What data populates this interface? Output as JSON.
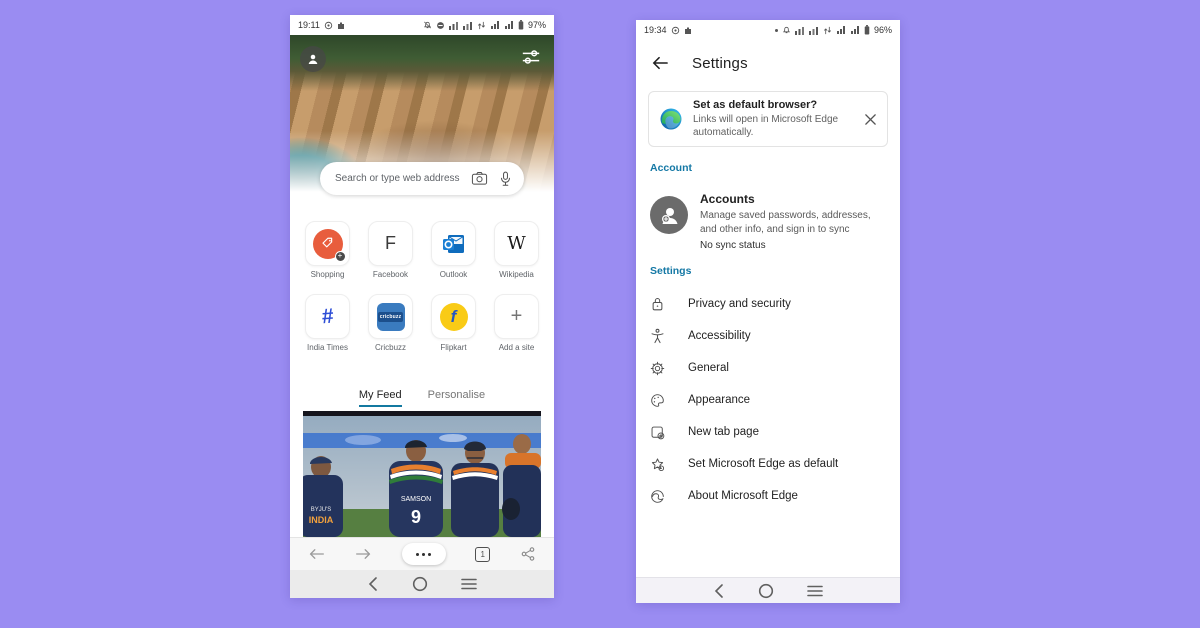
{
  "colors": {
    "page_background": "#9a8cf2",
    "accent_section": "#1478a5",
    "tab_underline": "#1379a0",
    "shopping_red": "#e85d3d",
    "flipkart_yellow": "#f9cb16",
    "edge_blue": "#0c59a4"
  },
  "left_phone": {
    "status": {
      "time": "19:11",
      "battery_pct": "97%"
    },
    "search": {
      "placeholder": "Search or type web address"
    },
    "shortcuts": [
      {
        "label": "Shopping"
      },
      {
        "label": "Facebook",
        "letter": "F"
      },
      {
        "label": "Outlook"
      },
      {
        "label": "Wikipedia",
        "letter": "W"
      },
      {
        "label": "India Times",
        "letter": "#"
      },
      {
        "label": "Cricbuzz",
        "logo_text": "cricbuzz"
      },
      {
        "label": "Flipkart",
        "letter": "f"
      },
      {
        "label": "Add a site",
        "letter": "+"
      }
    ],
    "tabs": {
      "feed": "My Feed",
      "personalise": "Personalise"
    },
    "feed": {
      "sponsor": "BYJU'S",
      "jersey_text": "INDIA",
      "player_name": "SAMSON",
      "player_number": "9"
    },
    "toolbar": {
      "tab_count": "1"
    }
  },
  "right_phone": {
    "status": {
      "time": "19:34",
      "battery_pct": "96%"
    },
    "header": {
      "title": "Settings"
    },
    "banner": {
      "title": "Set as default browser?",
      "body": "Links will open in Microsoft Edge automatically."
    },
    "account_section": {
      "label": "Account",
      "item": {
        "title": "Accounts",
        "desc": "Manage saved passwords, addresses, and other info, and sign in to sync",
        "status": "No sync status"
      }
    },
    "settings_section": {
      "label": "Settings",
      "items": [
        {
          "label": "Privacy and security"
        },
        {
          "label": "Accessibility"
        },
        {
          "label": "General"
        },
        {
          "label": "Appearance"
        },
        {
          "label": "New tab page"
        },
        {
          "label": "Set Microsoft Edge as default"
        },
        {
          "label": "About Microsoft Edge"
        }
      ]
    }
  }
}
